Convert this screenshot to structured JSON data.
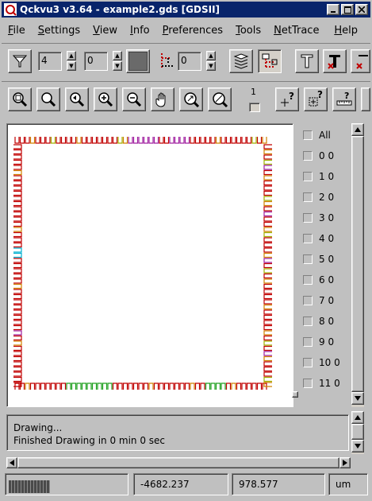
{
  "window": {
    "title": "Qckvu3 v3.64 - example2.gds [GDSII]"
  },
  "menu": {
    "items": [
      {
        "label": "File",
        "key": "F",
        "rest": "ile"
      },
      {
        "label": "Settings",
        "key": "S",
        "rest": "ettings"
      },
      {
        "label": "View",
        "key": "V",
        "rest": "iew"
      },
      {
        "label": "Info",
        "key": "I",
        "rest": "nfo"
      },
      {
        "label": "Preferences",
        "key": "P",
        "rest": "references"
      },
      {
        "label": "Tools",
        "key": "T",
        "rest": "ools"
      },
      {
        "label": "NetTrace",
        "key": "N",
        "rest": "etTrace"
      },
      {
        "label": "Help",
        "key": "H",
        "rest": "elp"
      }
    ]
  },
  "toolbar1": {
    "depth_value": "4",
    "level_value": "0",
    "hier_value": "0"
  },
  "toolbar2": {
    "level_label": "1"
  },
  "layers": [
    {
      "label": "All"
    },
    {
      "label": "0 0"
    },
    {
      "label": "1 0"
    },
    {
      "label": "2 0"
    },
    {
      "label": "3 0"
    },
    {
      "label": "4 0"
    },
    {
      "label": "5 0"
    },
    {
      "label": "6 0"
    },
    {
      "label": "7 0"
    },
    {
      "label": "8 0"
    },
    {
      "label": "9 0"
    },
    {
      "label": "10 0"
    },
    {
      "label": "11 0"
    }
  ],
  "status": {
    "line1": "Drawing...",
    "line2": "Finished Drawing in 0 min 0 sec"
  },
  "statusbar": {
    "x_coord": "-4682.237",
    "y_coord": "978.577",
    "units": "um"
  },
  "colors": {
    "titlebar": "#08246b",
    "pad_red": "#c00000",
    "pad_magenta": "#a020a0",
    "pad_orange": "#d08000",
    "pad_green": "#20a020",
    "pad_cyan": "#00b0d0",
    "pad_yellowgreen": "#a0b000"
  }
}
